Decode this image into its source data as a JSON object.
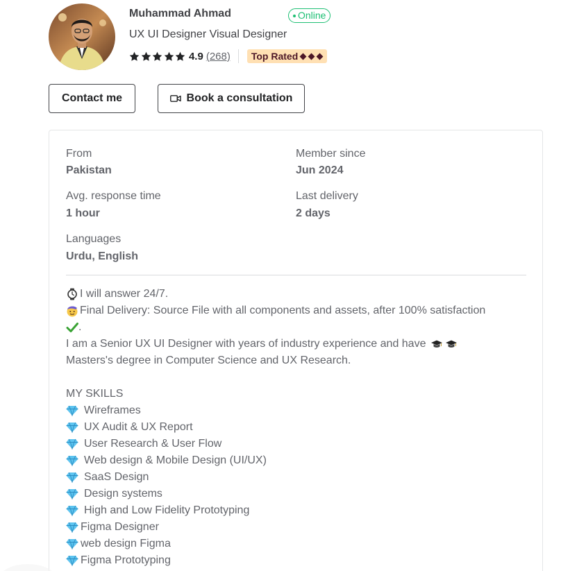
{
  "profile": {
    "name": "Muhammad Ahmad",
    "status": "Online",
    "tagline": "UX UI Designer Visual Designer",
    "rating": "4.9",
    "review_count": "(268)",
    "badge": "Top Rated",
    "stars": 5
  },
  "actions": {
    "contact_label": "Contact me",
    "book_label": "Book a consultation"
  },
  "stats": {
    "from_label": "From",
    "from_value": "Pakistan",
    "member_label": "Member since",
    "member_value": "Jun 2024",
    "response_label": "Avg. response time",
    "response_value": "1 hour",
    "delivery_label": "Last delivery",
    "delivery_value": "2 days",
    "languages_label": "Languages",
    "languages_value": "Urdu, English"
  },
  "description": {
    "line1": "I will answer 24/7.",
    "line2": "Final Delivery: Source File with all components and assets, after 100% satisfaction",
    "line3": ".",
    "line4": "I am a Senior UX UI Designer with years of industry experience and have",
    "line5": "Masters's degree in Computer Science and UX Research.",
    "skills_heading": "MY SKILLS",
    "skills": [
      "Wireframes",
      "UX Audit & UX Report",
      "User Research & User Flow",
      "Web design & Mobile Design (UI/UX)",
      "SaaS Design",
      "Design systems",
      "High and Low Fidelity Prototyping",
      "Figma Designer",
      "web design Figma",
      "Figma Prototyping"
    ]
  },
  "colors": {
    "online_green": "#1dbf73",
    "badge_bg": "#ffe0b3",
    "badge_text": "#4d1727",
    "text_dark": "#404145",
    "text_muted": "#62646a"
  },
  "icons": [
    "star-icon",
    "video-icon",
    "watch-icon",
    "face-emoji-icon",
    "check-mark-icon",
    "graduation-cap-icon",
    "diamond-gem-icon"
  ]
}
